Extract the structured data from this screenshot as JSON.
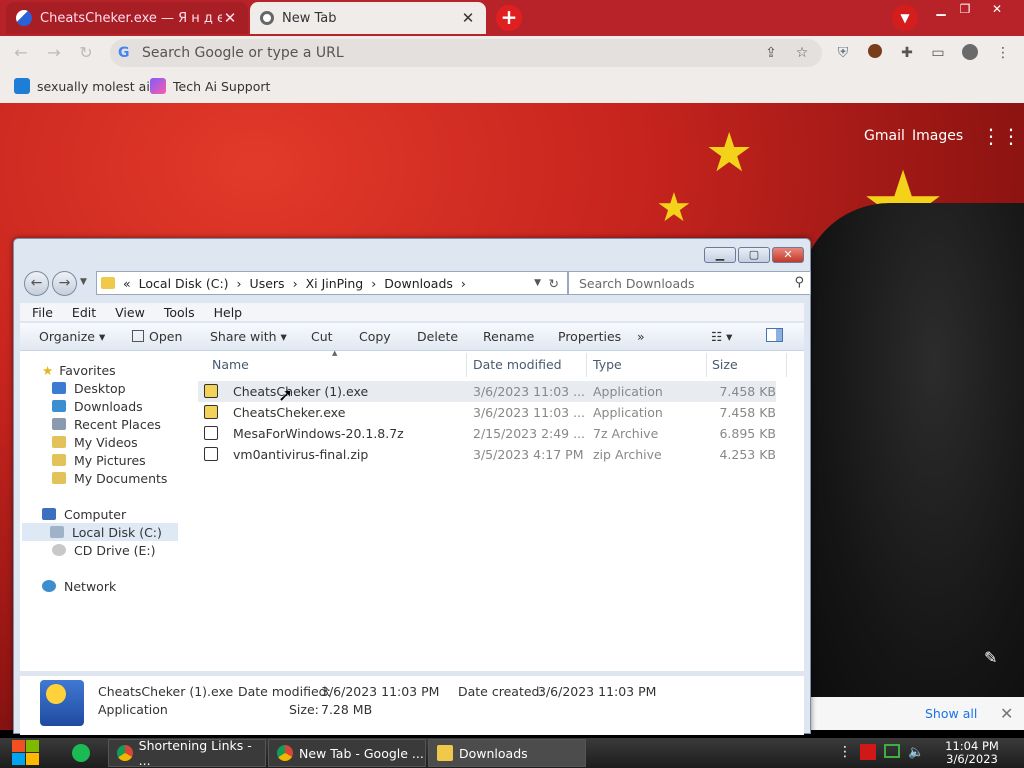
{
  "browser": {
    "tabs": [
      {
        "title": "CheatsCheker.exe — Я н д е",
        "active": false
      },
      {
        "title": "New Tab",
        "active": true
      }
    ],
    "newtab_icon": "+",
    "omnibox_placeholder": "Search Google or type a URL",
    "bookmarks": [
      {
        "label": "sexually molest ai"
      },
      {
        "label": "Tech Ai Support"
      }
    ]
  },
  "newtab_page": {
    "gmail": "Gmail",
    "images": "Images",
    "show_all": "Show all"
  },
  "explorer": {
    "breadcrumb": [
      "Local Disk (C:)",
      "Users",
      "Xi JinPing",
      "Downloads"
    ],
    "search_placeholder": "Search Downloads",
    "menu": [
      "File",
      "Edit",
      "View",
      "Tools",
      "Help"
    ],
    "commands": {
      "organize": "Organize",
      "open": "Open",
      "share": "Share with",
      "cut": "Cut",
      "copy": "Copy",
      "delete": "Delete",
      "rename": "Rename",
      "properties": "Properties",
      "more": "»"
    },
    "nav": {
      "favorites": "Favorites",
      "favorites_items": [
        "Desktop",
        "Downloads",
        "Recent Places",
        "My Videos",
        "My Pictures",
        "My Documents"
      ],
      "computer": "Computer",
      "computer_items": [
        "Local Disk (C:)",
        "CD Drive (E:)"
      ],
      "network": "Network"
    },
    "columns": {
      "name": "Name",
      "date": "Date modified",
      "type": "Type",
      "size": "Size"
    },
    "files": [
      {
        "name": "CheatsCheker (1).exe",
        "date": "3/6/2023 11:03 ...",
        "type": "Application",
        "size": "7.458 KB"
      },
      {
        "name": "CheatsCheker.exe",
        "date": "3/6/2023 11:03 ...",
        "type": "Application",
        "size": "7.458 KB"
      },
      {
        "name": "MesaForWindows-20.1.8.7z",
        "date": "2/15/2023 2:49 ...",
        "type": "7z Archive",
        "size": "6.895 KB"
      },
      {
        "name": "vm0antivirus-final.zip",
        "date": "3/5/2023 4:17 PM",
        "type": "zip Archive",
        "size": "4.253 KB"
      }
    ],
    "details": {
      "filename": "CheatsCheker (1).exe",
      "kind": "Application",
      "date_modified_label": "Date modified:",
      "date_modified": "3/6/2023 11:03 PM",
      "date_created_label": "Date created:",
      "date_created": "3/6/2023 11:03 PM",
      "size_label": "Size:",
      "size": "7.28 MB"
    }
  },
  "taskbar": {
    "apps": [
      {
        "label": "Shortening Links - ..."
      },
      {
        "label": "New Tab - Google ..."
      },
      {
        "label": "Downloads"
      }
    ],
    "time": "11:04 PM",
    "date": "3/6/2023"
  },
  "colors": {
    "tab_strip": "#b8232a",
    "flag_red": "#c7241e",
    "star": "#f5d21a",
    "link": "#1a73e8"
  }
}
